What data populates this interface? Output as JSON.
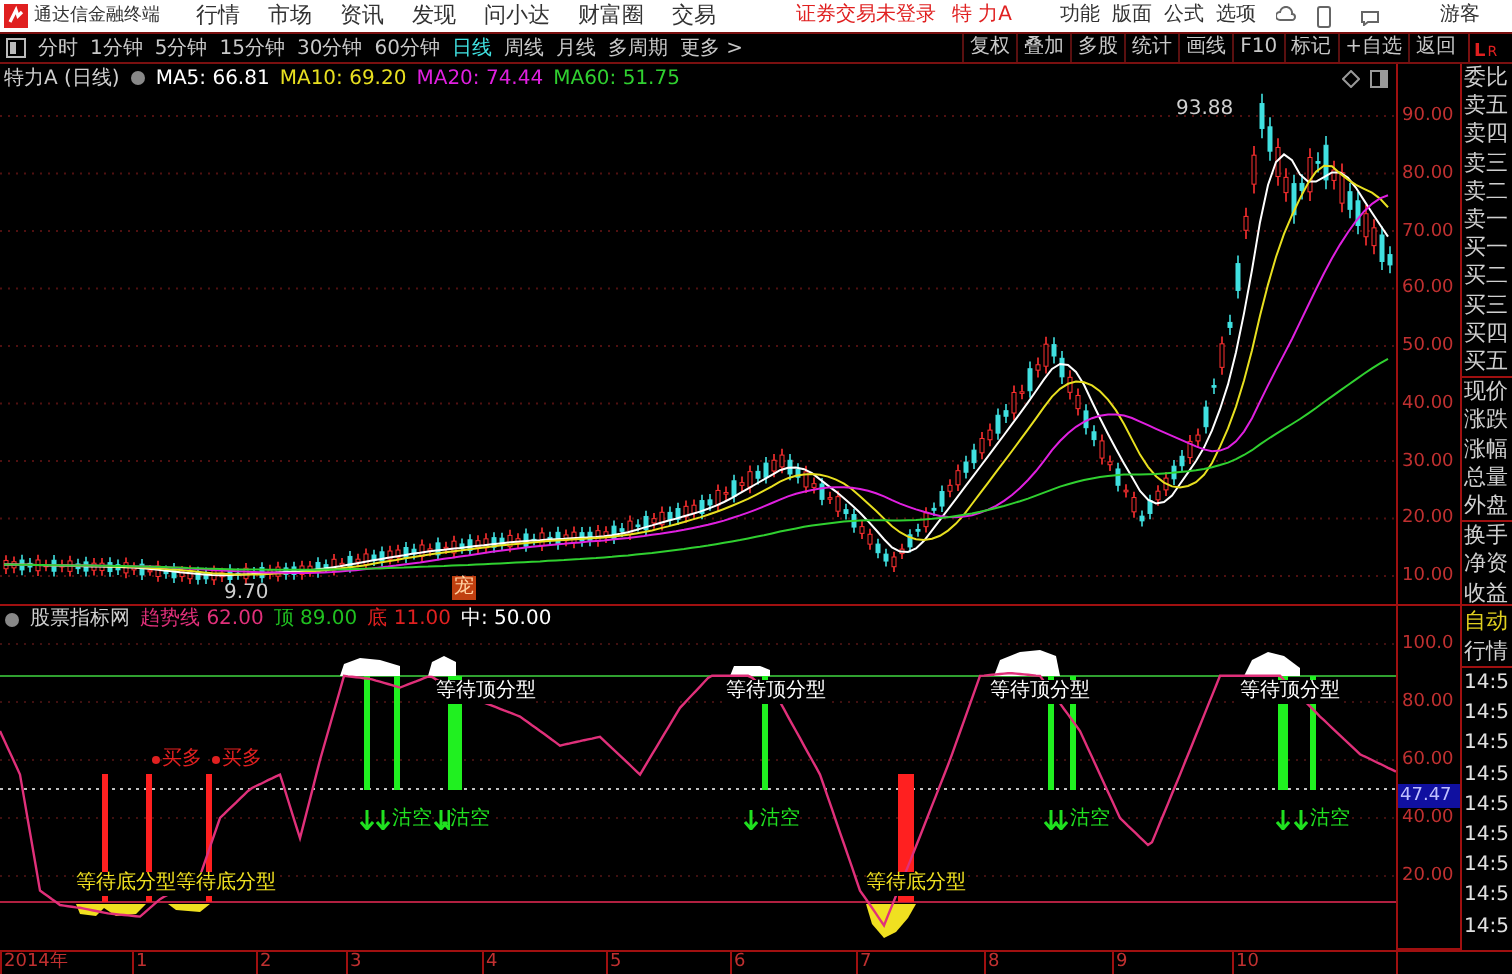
{
  "app": {
    "title": "通达信金融终端",
    "menus": [
      "行情",
      "市场",
      "资讯",
      "发现",
      "问小达",
      "财富圈",
      "交易"
    ],
    "login_status": "证券交易未登录",
    "stock": "特 力A",
    "tools": [
      "功能",
      "版面",
      "公式",
      "选项"
    ],
    "user": "游客"
  },
  "periods": [
    {
      "label": "分时",
      "selected": false
    },
    {
      "label": "1分钟",
      "selected": false
    },
    {
      "label": "5分钟",
      "selected": false
    },
    {
      "label": "15分钟",
      "selected": false
    },
    {
      "label": "30分钟",
      "selected": false
    },
    {
      "label": "60分钟",
      "selected": false
    },
    {
      "label": "日线",
      "selected": true
    },
    {
      "label": "周线",
      "selected": false
    },
    {
      "label": "月线",
      "selected": false
    },
    {
      "label": "多周期",
      "selected": false
    },
    {
      "label": "更多 >",
      "selected": false
    }
  ],
  "toolbar_buttons": [
    "复权",
    "叠加",
    "多股",
    "统计",
    "画线",
    "F10",
    "标记",
    "+自选",
    "返回"
  ],
  "panel_toggle": {
    "left": "L",
    "right": "R"
  },
  "main_chart": {
    "title": "特力A (日线)",
    "indicators": [
      {
        "label": "MA5: 66.81",
        "color": "#ffffff"
      },
      {
        "label": "MA10: 69.20",
        "color": "#e8e020"
      },
      {
        "label": "MA20: 74.44",
        "color": "#e020e0"
      },
      {
        "label": "MA60: 51.75",
        "color": "#30d030"
      }
    ],
    "high_label": "93.88",
    "low_label": "9.70",
    "marker": "宠",
    "yaxis": [
      "90.00",
      "80.00",
      "70.00",
      "60.00",
      "50.00",
      "40.00",
      "30.00",
      "20.00",
      "10.00"
    ]
  },
  "indicator_chart": {
    "title": "股票指标网",
    "values": [
      {
        "name": "趋势线",
        "value": "62.00",
        "color": "#e0307a"
      },
      {
        "name": "顶",
        "value": "89.00",
        "color": "#20c020"
      },
      {
        "name": "底",
        "value": "11.00",
        "color": "#e02020"
      },
      {
        "name": "中:",
        "value": "50.00",
        "color": "#ffffff"
      }
    ],
    "labels": [
      {
        "kind": "top",
        "text": "等待顶分型"
      },
      {
        "kind": "top",
        "text": "等待顶分型"
      },
      {
        "kind": "top",
        "text": "等待顶分型"
      },
      {
        "kind": "top",
        "text": "等待顶分型"
      },
      {
        "kind": "buy",
        "text": "买多"
      },
      {
        "kind": "buy",
        "text": "买多"
      },
      {
        "kind": "short",
        "text": "沽空"
      },
      {
        "kind": "short",
        "text": "沽空"
      },
      {
        "kind": "short",
        "text": "沽空"
      },
      {
        "kind": "short",
        "text": "沽空"
      },
      {
        "kind": "short",
        "text": "沽空"
      },
      {
        "kind": "bottom",
        "text": "等待底分型"
      },
      {
        "kind": "bottom",
        "text": "等待底分型"
      },
      {
        "kind": "bottom",
        "text": "等待底分型"
      }
    ],
    "yaxis": [
      "100.0",
      "80.00",
      "60.00",
      "40.00",
      "20.00"
    ],
    "current": "47.47"
  },
  "dates": [
    "2014年",
    "1",
    "2",
    "3",
    "4",
    "5",
    "6",
    "7",
    "8",
    "9",
    "10"
  ],
  "quote_panel": {
    "fields": [
      "委比",
      "卖五",
      "卖四",
      "卖三",
      "卖二",
      "卖一",
      "买一",
      "买二",
      "买三",
      "买四",
      "买五",
      "现价",
      "涨跌",
      "涨幅",
      "总量",
      "外盘",
      "换手",
      "净资",
      "收益"
    ],
    "tabs": [
      {
        "label": "自动",
        "selected": true
      },
      {
        "label": "行情",
        "selected": false
      }
    ],
    "times": [
      "14:5",
      "14:5",
      "14:5",
      "14:5",
      "14:5",
      "14:5",
      "14:5",
      "14:5",
      "14:5"
    ]
  }
}
